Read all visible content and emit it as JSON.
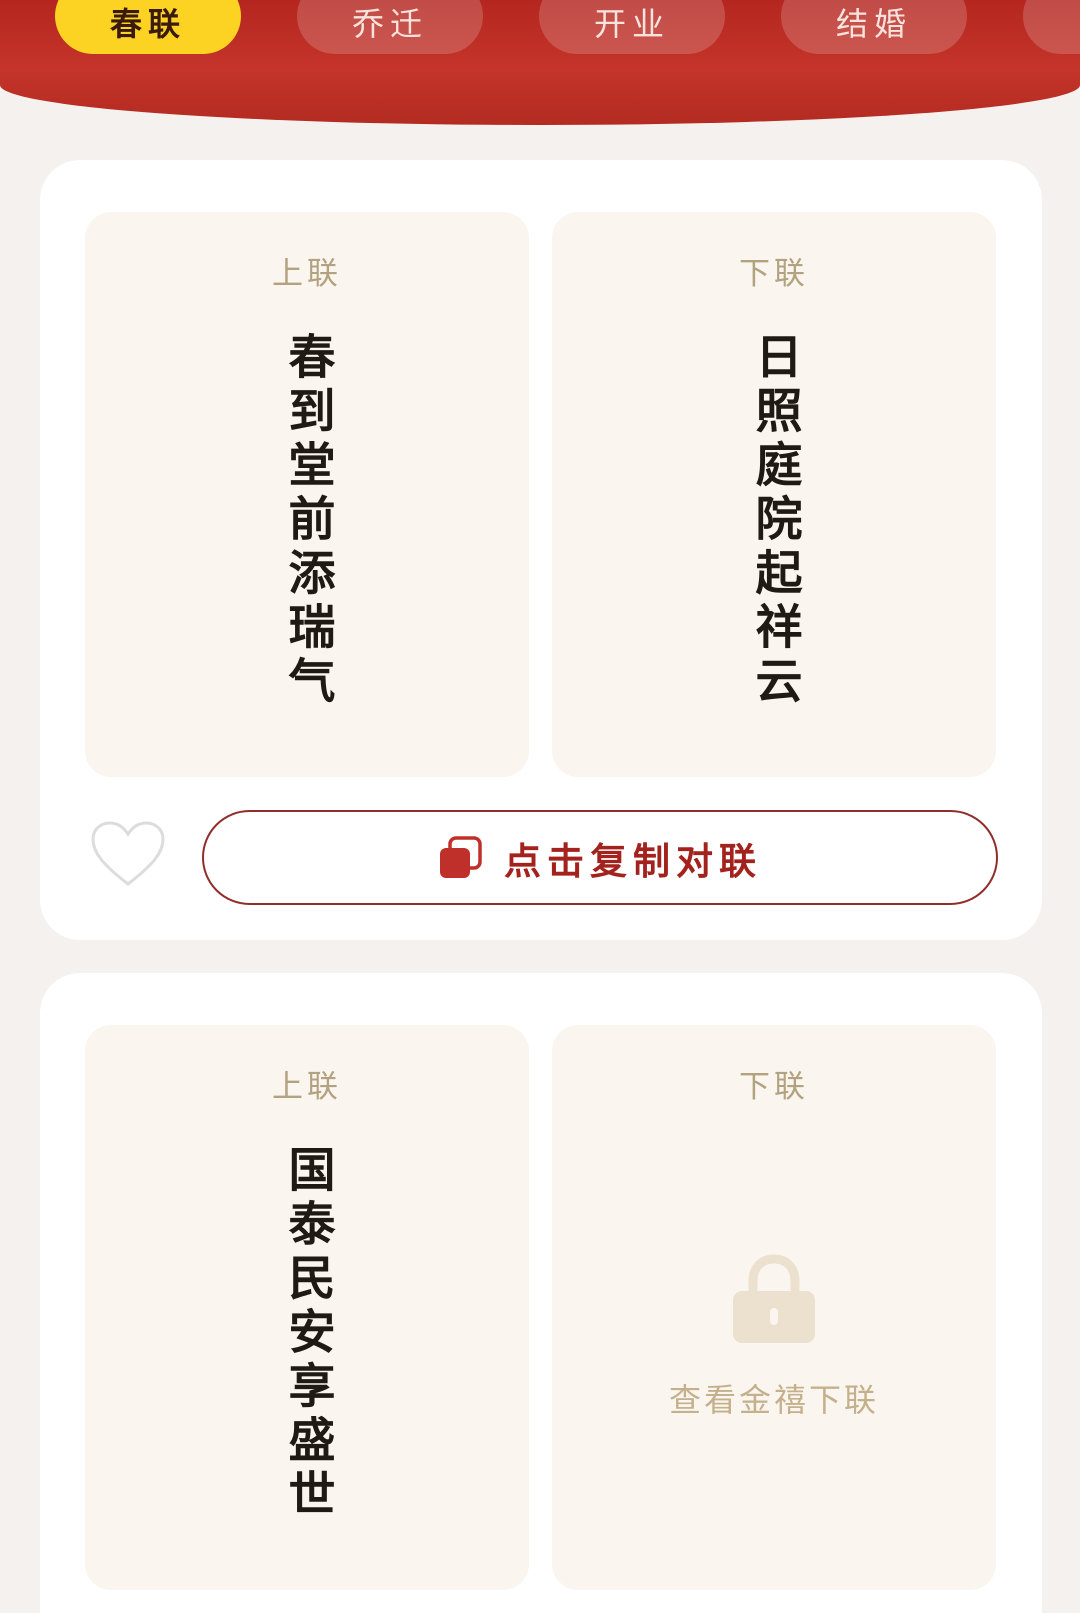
{
  "header": {
    "tabs": [
      {
        "label": "春联",
        "active": true
      },
      {
        "label": "乔迁",
        "active": false
      },
      {
        "label": "开业",
        "active": false
      },
      {
        "label": "结婚",
        "active": false
      }
    ]
  },
  "cards": [
    {
      "left_label": "上联",
      "left_text": "春到堂前添瑞气",
      "right_label": "下联",
      "right_text": "日照庭院起祥云",
      "copy_label": "点击复制对联"
    },
    {
      "left_label": "上联",
      "left_text": "国泰民安享盛世",
      "right_label": "下联",
      "locked_text": "查看金禧下联"
    }
  ],
  "colors": {
    "header_red": "#c4342a",
    "active_tab": "#fcd323",
    "accent_red": "#a4221d"
  }
}
